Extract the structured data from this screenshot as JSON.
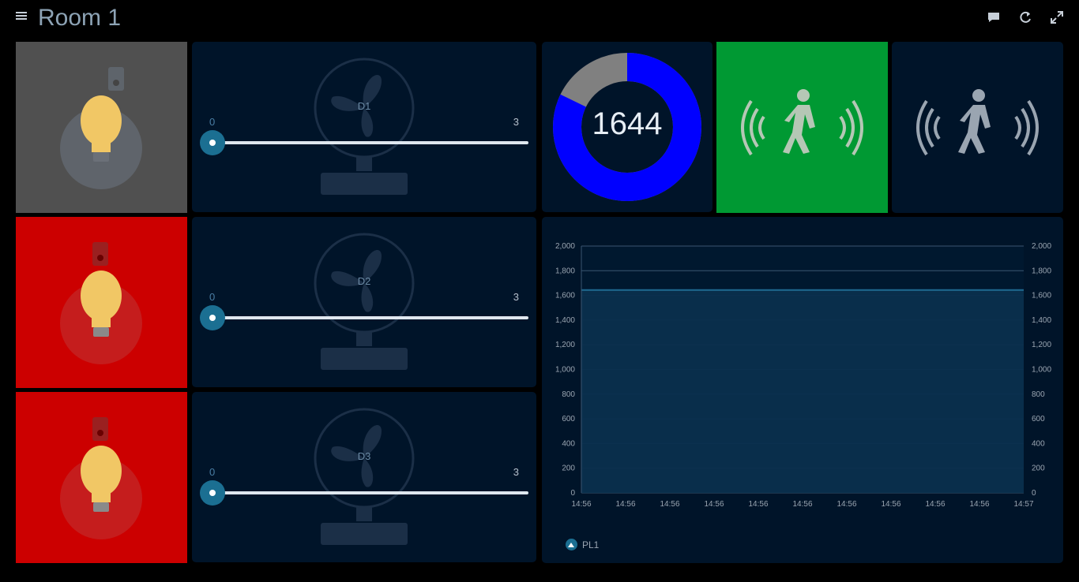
{
  "header": {
    "title": "Room 1",
    "icons": [
      "menu-icon",
      "chat-icon",
      "refresh-icon",
      "fullscreen-icon"
    ]
  },
  "lights": [
    {
      "state": "off",
      "bg": "#505050"
    },
    {
      "state": "on",
      "bg": "#cc0000"
    },
    {
      "state": "on",
      "bg": "#cc0000"
    }
  ],
  "fans": [
    {
      "name": "D1",
      "min": "0",
      "max": "3",
      "value": 0
    },
    {
      "name": "D2",
      "min": "0",
      "max": "3",
      "value": 0
    },
    {
      "name": "D3",
      "min": "0",
      "max": "3",
      "value": 0
    }
  ],
  "gauge": {
    "value": "1644",
    "fraction": 0.822,
    "fill_color": "#0000ff",
    "rest_color": "#808080"
  },
  "motion": [
    {
      "state": "detected",
      "bg": "#009933"
    },
    {
      "state": "idle",
      "bg": "#001429"
    }
  ],
  "chart_data": {
    "type": "area",
    "x": [
      "14:56",
      "14:56",
      "14:56",
      "14:56",
      "14:56",
      "14:56",
      "14:56",
      "14:56",
      "14:56",
      "14:56",
      "14:57"
    ],
    "series": [
      {
        "name": "PL1",
        "values": [
          1644,
          1644,
          1644,
          1644,
          1644,
          1644,
          1644,
          1644,
          1644,
          1644,
          1644
        ]
      }
    ],
    "ylim": [
      0,
      2000
    ],
    "yticks": [
      "0",
      "200",
      "400",
      "600",
      "800",
      "1,000",
      "1,200",
      "1,400",
      "1,600",
      "1,800",
      "2,000"
    ],
    "grid": true,
    "legend": "bottom-left"
  },
  "colors": {
    "tile_bg": "#001429",
    "accent": "#1b6f92",
    "series": "#0a2f4d",
    "series_line": "#1f6a91"
  }
}
